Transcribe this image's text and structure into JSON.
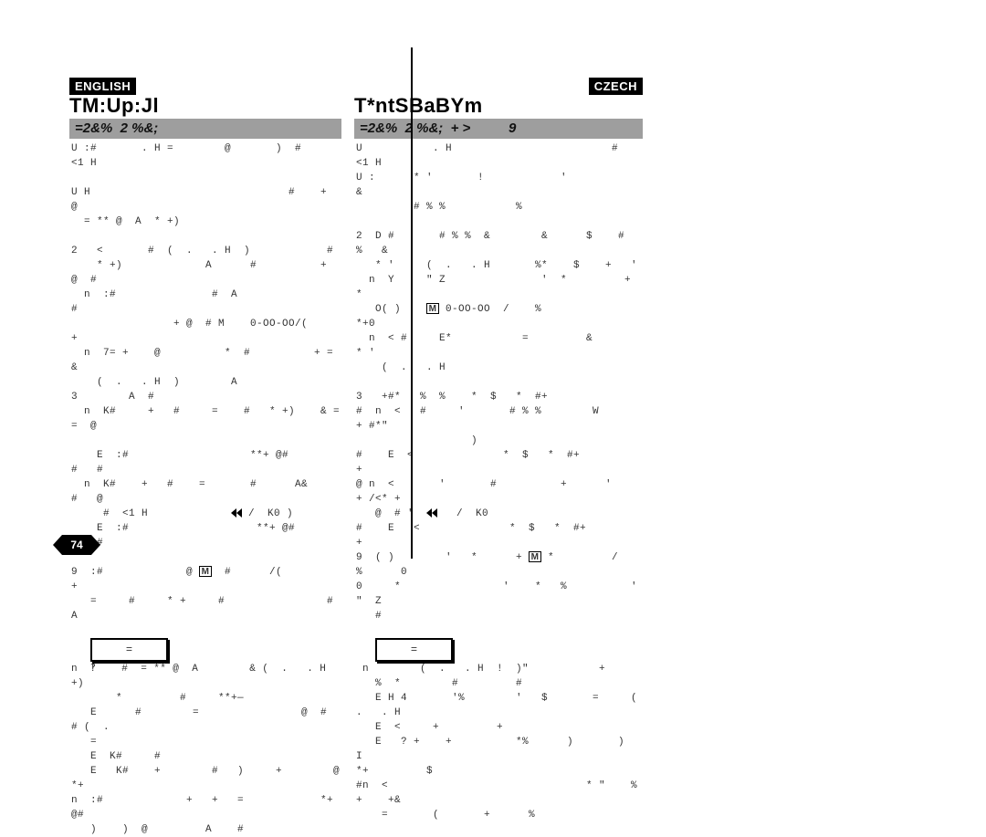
{
  "lang_left": "ENGLISH",
  "lang_right": "CZECH",
  "title_left": "TM:Up:Jl",
  "title_right": "T*ntSBaBYm",
  "bar_left": "=2&%  2 %&;",
  "bar_right": "=2&%  2 %&;  + >          9",
  "page_number": "74",
  "left_lines": [
    "U :#       . H =        @       )  #            <1 H",
    "",
    "U H                               #    +   @",
    "  = ** @  A  * +)",
    "",
    "2   <       #  (  .   . H  )            #",
    "    * +)             A      #          +   @  #",
    "  n  :#               #  A                      #",
    "                + @  # M    0-OO-OO/(          +",
    "  n  7= +    @          *  #          + =       &",
    "    (  .   . H  )        A",
    "3        A  #",
    "  n  K#     +   #     =    #   * +)    & =    =  @",
    "",
    "    E  :#                   **+ @#           #   #",
    "  n  K#    +   #    =       #      A&         #   @",
    "     #  <1 H             ◀◀ /  K0 )",
    "    E  :#                    **+ @#          #   #",
    "",
    "9  :#             @ M  #      /(         +",
    "   =     #     * +     #                #  A",
    "",
    "   [NOTE]",
    "n  ‽    #  = ** @  A        & (  .   . H  +)",
    "       *         #     **+—",
    "   E      #        =                @  #  # (  .",
    "   =",
    "   E  K#     #",
    "   E   K#    +        #   )     +        @     *+",
    "n  :#             +   +   =            *+ @#",
    "   )    )  @         A    #"
  ],
  "right_lines": [
    "U           . H                         #         <1 H",
    "U :      * '       !            '                  &",
    "         # % %           %",
    "",
    "2  D #       # % %  &        &      $    #     %   &",
    "   * '     (  .   . H       %*    $    +   '",
    "  n  Y     \" Z               '  *         +  *",
    "   O( )    M 0-OO-OO  /    %               *+0",
    "  n  < #     E*           =         &         * '",
    "    (  .   . H",
    "",
    "3   +#*   %  %    *  $   *  #+",
    "#  n  <   #     '       # % %        W         + #*\"",
    "                  )",
    "#    E  <              *  $   *  #+               +",
    "@ n  <       '       #          +      '     + /<* +",
    "   @  # '  ◀◀   /  K0",
    "#    E   <              *  $   *  #+              +",
    "9  ( )        '   *      + M *         /    %      0",
    "0     *                '    *   %          '    \"  Z",
    "   #",
    "",
    "   [NOTE]",
    " n        (  .   . H  !  )\"           +",
    "   %  *        #         #",
    "   E H 4       '%        '   $       =     (  .   . H",
    "   E  <     +         +",
    "   E   ? +    +          *%      )       )         I",
    "*+         $",
    "#n  <                               * \"    %   +    +&",
    "    =       (       +      %"
  ]
}
